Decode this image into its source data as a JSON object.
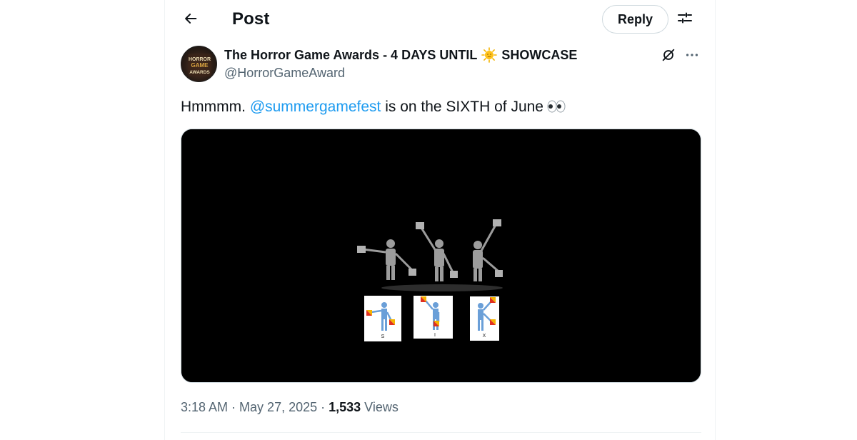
{
  "header": {
    "title": "Post",
    "reply_label": "Reply",
    "back_icon": "arrow-left-icon",
    "settings_icon": "sliders-icon"
  },
  "author": {
    "name_part1": "The Horror Game Awards - 4 DAYS UNTIL",
    "name_emoji": "sun-emoji-icon",
    "name_part2": "SHOWCASE",
    "handle": "@HorrorGameAward",
    "avatar_text": [
      "HORROR",
      "GAME",
      "AWARDS"
    ]
  },
  "tweet": {
    "text_prefix": "Hmmmm. ",
    "mention": "@summergamefest",
    "text_suffix": " is on the SIXTH of June",
    "emoji": "eyes-emoji-icon"
  },
  "media": {
    "type": "video",
    "cards": [
      "S",
      "I",
      "X"
    ]
  },
  "meta": {
    "time": "3:18 AM",
    "sep1": " · ",
    "date": "May 27, 2025",
    "sep2": " · ",
    "views": "1,533",
    "views_label": " Views"
  },
  "colors": {
    "accent": "#1d9bf0",
    "text": "#0f1419",
    "secondary": "#536471",
    "border": "#cfd9de"
  }
}
